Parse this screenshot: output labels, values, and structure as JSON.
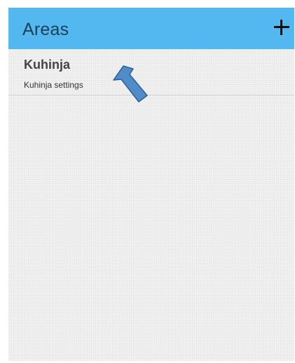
{
  "app_bar": {
    "title": "Areas",
    "add_icon": "plus-icon",
    "color": "#52b8ef"
  },
  "areas": [
    {
      "name": "Kuhinja",
      "subtitle": "Kuhinja settings"
    }
  ],
  "annotation": {
    "arrow_icon": "arrow-up-left-icon",
    "color": "#4f8cc9"
  }
}
